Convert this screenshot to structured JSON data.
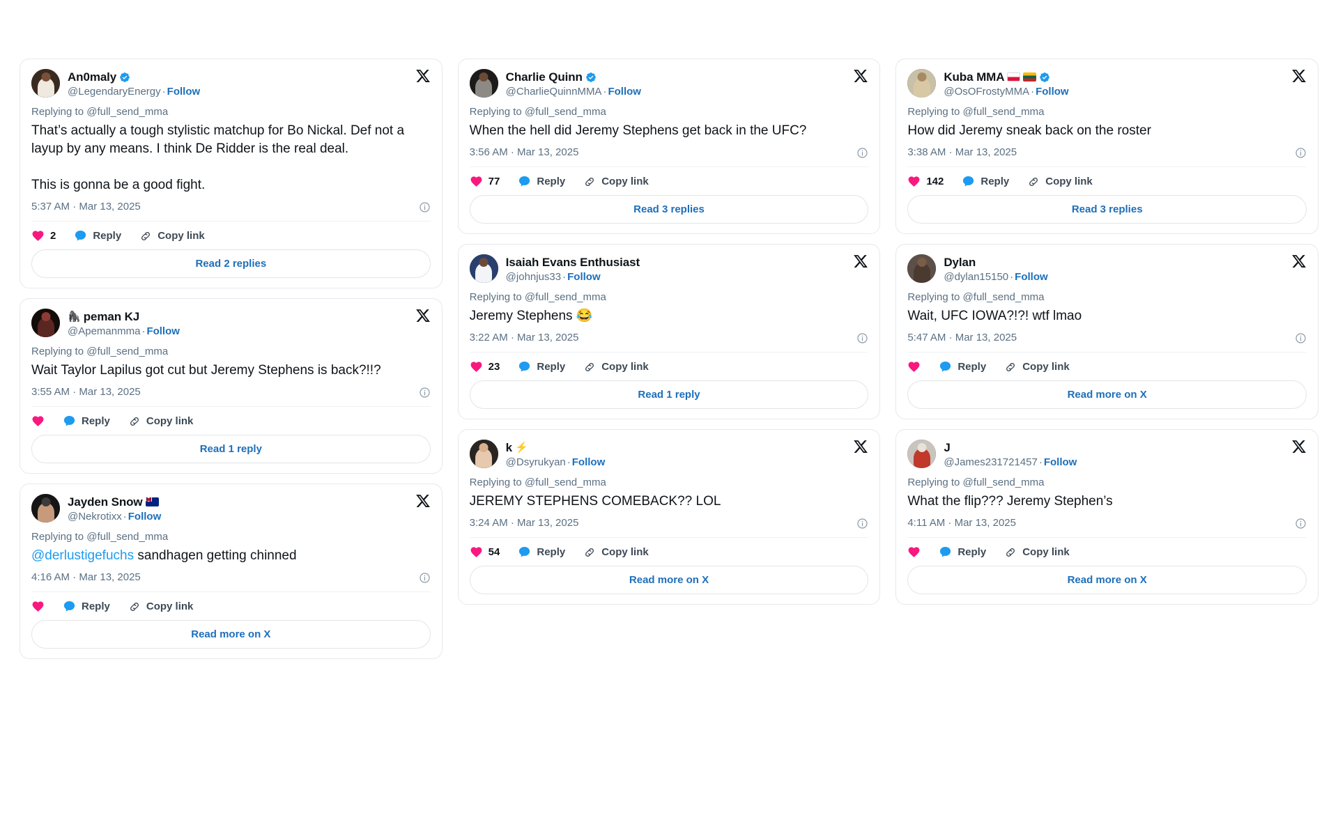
{
  "page": {
    "background_color": "#ffffff",
    "accent_link_color": "#1d6fba",
    "mention_color": "#1d9bf0",
    "heart_color": "#f91880",
    "reply_bubble_color": "#1d9bf0",
    "verified_badge_color": "#1d9bf0"
  },
  "labels": {
    "replying_to": "Replying to @full_send_mma",
    "follow": "Follow",
    "reply": "Reply",
    "copy_link": "Copy link",
    "dot_separator": "·"
  },
  "icons": {
    "x_logo": "x-logo-icon",
    "verified": "verified-badge-icon",
    "info": "info-circle-icon",
    "heart": "heart-icon",
    "bubble": "reply-bubble-icon",
    "link": "copy-link-icon"
  },
  "columns": [
    {
      "id": "column-1",
      "cards": [
        {
          "id": "card-an0maly",
          "display_name": "An0maly",
          "verified": true,
          "emoji_prefix": "",
          "flags": [],
          "handle": "@LegendaryEnergy",
          "follow": "Follow",
          "replying_to": "Replying to @full_send_mma",
          "text": "That’s actually a tough stylistic matchup for Bo Nickal. Def not a layup by any means. I think De Ridder is the real deal.\n\nThis is gonna be a good fight.",
          "mention": "",
          "timestamp": "5:37 AM · Mar 13, 2025",
          "like_count": "2",
          "read_label": "Read 2 replies",
          "avatar": {
            "bg": "#3a2b21",
            "figure": "#efe9df",
            "head": "#7a5038"
          }
        },
        {
          "id": "card-apeman-kj",
          "display_name": "peman KJ",
          "verified": false,
          "emoji_prefix": "🦍",
          "flags": [],
          "handle": "@Apemanmma",
          "follow": "Follow",
          "replying_to": "Replying to @full_send_mma",
          "text": "Wait Taylor Lapilus got cut but Jeremy Stephens is back?!!?",
          "mention": "",
          "timestamp": "3:55 AM · Mar 13, 2025",
          "like_count": "",
          "read_label": "Read 1 reply",
          "avatar": {
            "bg": "#120c0b",
            "figure": "#5a2622",
            "head": "#8d3b33"
          }
        },
        {
          "id": "card-jayden-snow",
          "display_name": "Jayden Snow",
          "verified": false,
          "emoji_prefix": "",
          "flags": [
            "au"
          ],
          "handle": "@Nekrotixx",
          "follow": "Follow",
          "replying_to": "Replying to @full_send_mma",
          "text": " sandhagen getting chinned",
          "mention": "@derlustigefuchs",
          "timestamp": "4:16 AM · Mar 13, 2025",
          "like_count": "",
          "read_label": "Read more on X",
          "avatar": {
            "bg": "#151515",
            "figure": "#c79a7c",
            "head": "#3b3b3b"
          }
        }
      ]
    },
    {
      "id": "column-2",
      "cards": [
        {
          "id": "card-charlie-quinn",
          "display_name": "Charlie Quinn",
          "verified": true,
          "emoji_prefix": "",
          "flags": [],
          "handle": "@CharlieQuinnMMA",
          "follow": "Follow",
          "replying_to": "Replying to @full_send_mma",
          "text": "When the hell did Jeremy Stephens get back in the UFC?",
          "mention": "",
          "timestamp": "3:56 AM · Mar 13, 2025",
          "like_count": "77",
          "read_label": "Read 3 replies",
          "avatar": {
            "bg": "#1d1b1a",
            "figure": "#8d8a86",
            "head": "#6b4a37"
          }
        },
        {
          "id": "card-isaiah-evans",
          "display_name": "Isaiah Evans Enthusiast",
          "verified": false,
          "emoji_prefix": "",
          "flags": [],
          "handle": "@johnjus33",
          "follow": "Follow",
          "replying_to": "Replying to @full_send_mma",
          "text": "Jeremy Stephens 😂",
          "mention": "",
          "timestamp": "3:22 AM · Mar 13, 2025",
          "like_count": "23",
          "read_label": "Read 1 reply",
          "avatar": {
            "bg": "#2a3f6e",
            "figure": "#f2f4f7",
            "head": "#6b4a37"
          }
        },
        {
          "id": "card-k",
          "display_name": "k",
          "verified": false,
          "emoji_prefix": "",
          "emoji_suffix": "⚡",
          "flags": [],
          "handle": "@Dsyrukyan",
          "follow": "Follow",
          "replying_to": "Replying to @full_send_mma",
          "text": "JEREMY STEPHENS COMEBACK?? LOL",
          "mention": "",
          "timestamp": "3:24 AM · Mar 13, 2025",
          "like_count": "54",
          "read_label": "Read more on X",
          "avatar": {
            "bg": "#2b2522",
            "figure": "#e7c9ae",
            "head": "#d8b08d"
          }
        }
      ]
    },
    {
      "id": "column-3",
      "cards": [
        {
          "id": "card-kuba-mma",
          "display_name": "Kuba MMA",
          "verified": true,
          "emoji_prefix": "",
          "flags": [
            "pl",
            "lt"
          ],
          "handle": "@OsOFrostyMMA",
          "follow": "Follow",
          "replying_to": "Replying to @full_send_mma",
          "text": "How did Jeremy sneak back on the roster",
          "mention": "",
          "timestamp": "3:38 AM · Mar 13, 2025",
          "like_count": "142",
          "read_label": "Read 3 replies",
          "avatar": {
            "bg": "#c8c1a8",
            "figure": "#d9c8a6",
            "head": "#a78a63"
          }
        },
        {
          "id": "card-dylan",
          "display_name": "Dylan",
          "verified": false,
          "emoji_prefix": "",
          "flags": [],
          "handle": "@dylan15150",
          "follow": "Follow",
          "replying_to": "Replying to @full_send_mma",
          "text": "Wait, UFC IOWA?!?! wtf lmao",
          "mention": "",
          "timestamp": "5:47 AM · Mar 13, 2025",
          "like_count": "",
          "read_label": "Read more on X",
          "avatar": {
            "bg": "#5d5048",
            "figure": "#4a3a30",
            "head": "#7a5d47"
          }
        },
        {
          "id": "card-j",
          "display_name": "J",
          "verified": false,
          "emoji_prefix": "",
          "flags": [],
          "handle": "@James231721457",
          "follow": "Follow",
          "replying_to": "Replying to @full_send_mma",
          "text": "What the flip??? Jeremy Stephen’s",
          "mention": "",
          "timestamp": "4:11 AM · Mar 13, 2025",
          "like_count": "",
          "read_label": "Read more on X",
          "avatar": {
            "bg": "#c9c4bd",
            "figure": "#c0392b",
            "head": "#e8e2d9"
          }
        }
      ]
    }
  ]
}
